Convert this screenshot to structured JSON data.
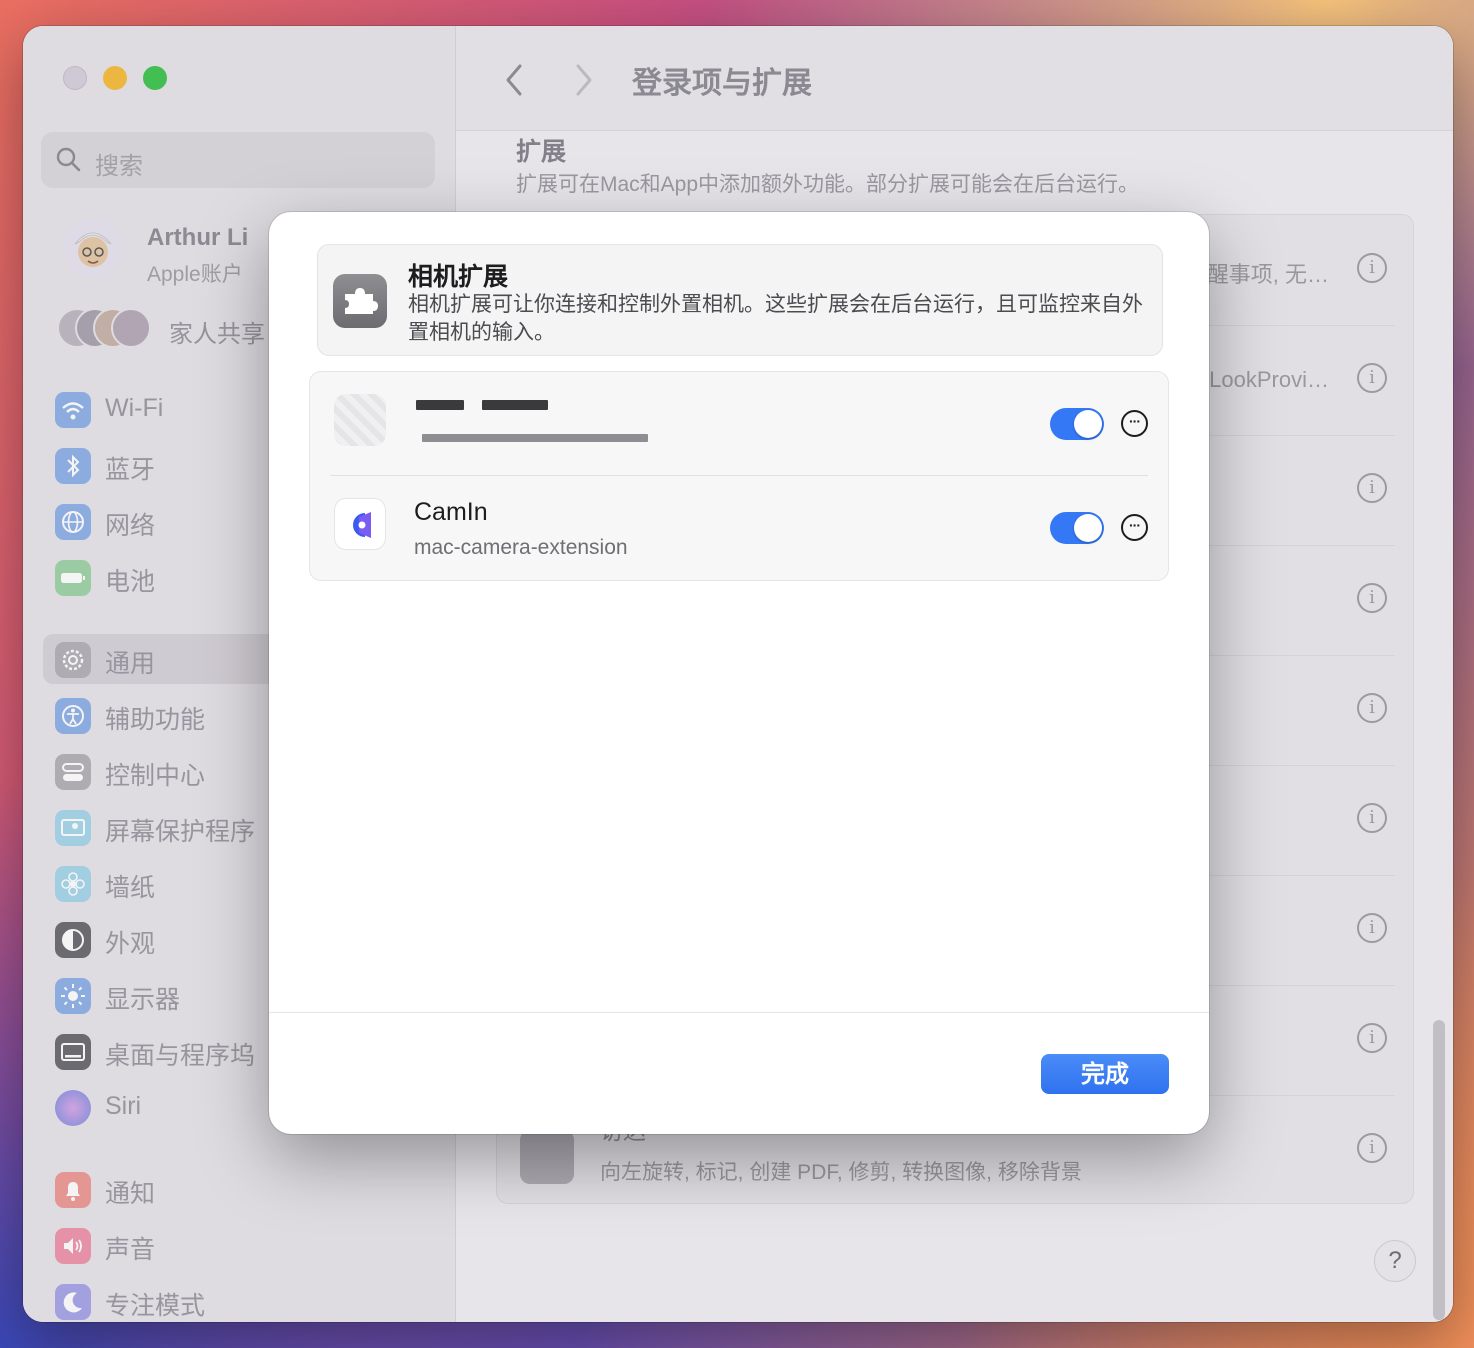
{
  "window": {
    "title": "登录项与扩展"
  },
  "sidebar": {
    "search_placeholder": "搜索",
    "account": {
      "name": "Arthur Li",
      "subtitle": "Apple账户"
    },
    "family_label": "家人共享",
    "items": [
      {
        "label": "Wi-Fi",
        "icon": "wifi-icon",
        "color": "#3478f6"
      },
      {
        "label": "蓝牙",
        "icon": "bluetooth-icon",
        "color": "#3478f6"
      },
      {
        "label": "网络",
        "icon": "globe-icon",
        "color": "#3478f6"
      },
      {
        "label": "电池",
        "icon": "battery-icon",
        "color": "#34c759"
      },
      {
        "label": "通用",
        "icon": "gear-icon",
        "color": "#8e8e93",
        "selected": true
      },
      {
        "label": "辅助功能",
        "icon": "accessibility-icon",
        "color": "#3478f6"
      },
      {
        "label": "控制中心",
        "icon": "control-center-icon",
        "color": "#8e8e93"
      },
      {
        "label": "屏幕保护程序",
        "icon": "screensaver-icon",
        "color": "#5ac8fa"
      },
      {
        "label": "墙纸",
        "icon": "wallpaper-icon",
        "color": "#5ac8fa"
      },
      {
        "label": "外观",
        "icon": "appearance-icon",
        "color": "#1d1d1f"
      },
      {
        "label": "显示器",
        "icon": "display-icon",
        "color": "#3478f6"
      },
      {
        "label": "桌面与程序坞",
        "icon": "dock-icon",
        "color": "#1d1d1f"
      },
      {
        "label": "Siri",
        "icon": "siri-icon",
        "color": "#5e5ce6"
      },
      {
        "label": "通知",
        "icon": "bell-icon",
        "color": "#ff3b30"
      },
      {
        "label": "声音",
        "icon": "speaker-icon",
        "color": "#ff2d55"
      },
      {
        "label": "专注模式",
        "icon": "moon-icon",
        "color": "#5e5ce6"
      }
    ]
  },
  "main": {
    "section_title": "扩展",
    "section_desc": "扩展可在Mac和App中添加额外功能。部分扩展可能会在后台运行。",
    "row_snippets": [
      "醒事项, 无…",
      "LookProvi…"
    ],
    "finder_row": {
      "name": "访达",
      "desc": "向左旋转, 标记, 创建 PDF, 修剪, 转换图像, 移除背景"
    },
    "help_label": "?"
  },
  "sheet": {
    "title": "相机扩展",
    "description": "相机扩展可让你连接和控制外置相机。这些扩展会在后台运行，且可监控来自外置相机的输入。",
    "extensions": [
      {
        "name": "",
        "bundle_id": "",
        "enabled": true,
        "redacted": true
      },
      {
        "name": "CamIn",
        "bundle_id": "mac-camera-extension",
        "enabled": true,
        "icon": "camin-app-icon"
      }
    ],
    "done_label": "完成"
  }
}
